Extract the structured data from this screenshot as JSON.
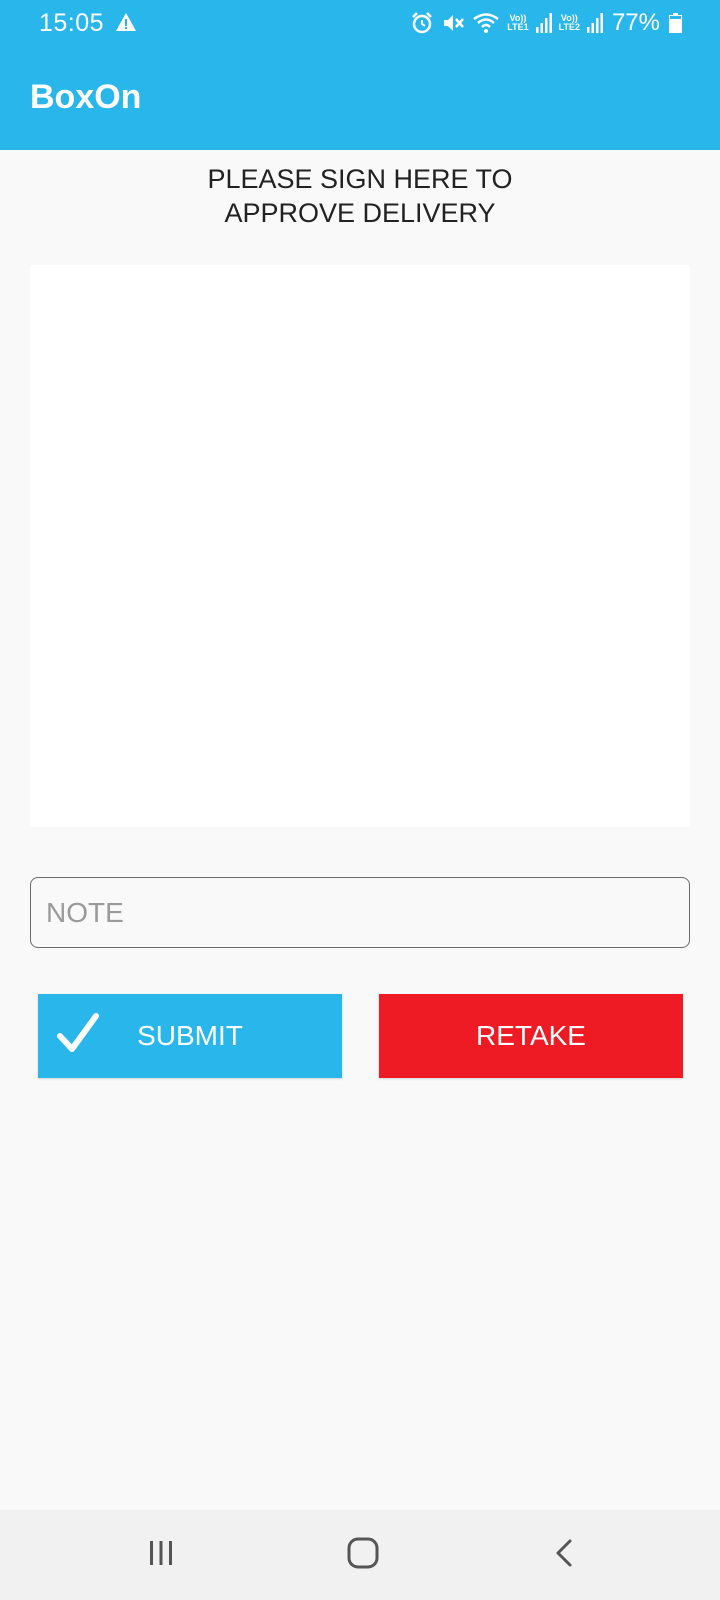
{
  "status_bar": {
    "time": "15:05",
    "sim1_label_top": "Vo))",
    "sim1_label_bottom": "LTE1",
    "sim2_label_top": "Vo))",
    "sim2_label_bottom": "LTE2",
    "battery_percent": "77%",
    "battery_level": 0.77,
    "icons": [
      "warning-icon",
      "alarm-icon",
      "mute-icon",
      "wifi-icon",
      "signal-icon",
      "battery-icon"
    ]
  },
  "app_bar": {
    "title": "BoxOn"
  },
  "main": {
    "instruction_line1": "PLEASE SIGN HERE TO",
    "instruction_line2": "APPROVE DELIVERY",
    "note_placeholder": "NOTE",
    "note_value": "",
    "submit_label": "SUBMIT",
    "retake_label": "RETAKE"
  },
  "nav_bar": {
    "icons": [
      "recent-apps-icon",
      "home-icon",
      "back-icon"
    ]
  },
  "colors": {
    "primary": "#29b6ea",
    "danger": "#ee1b25",
    "background": "#f9f9f9",
    "nav_background": "#f1f1f1"
  }
}
